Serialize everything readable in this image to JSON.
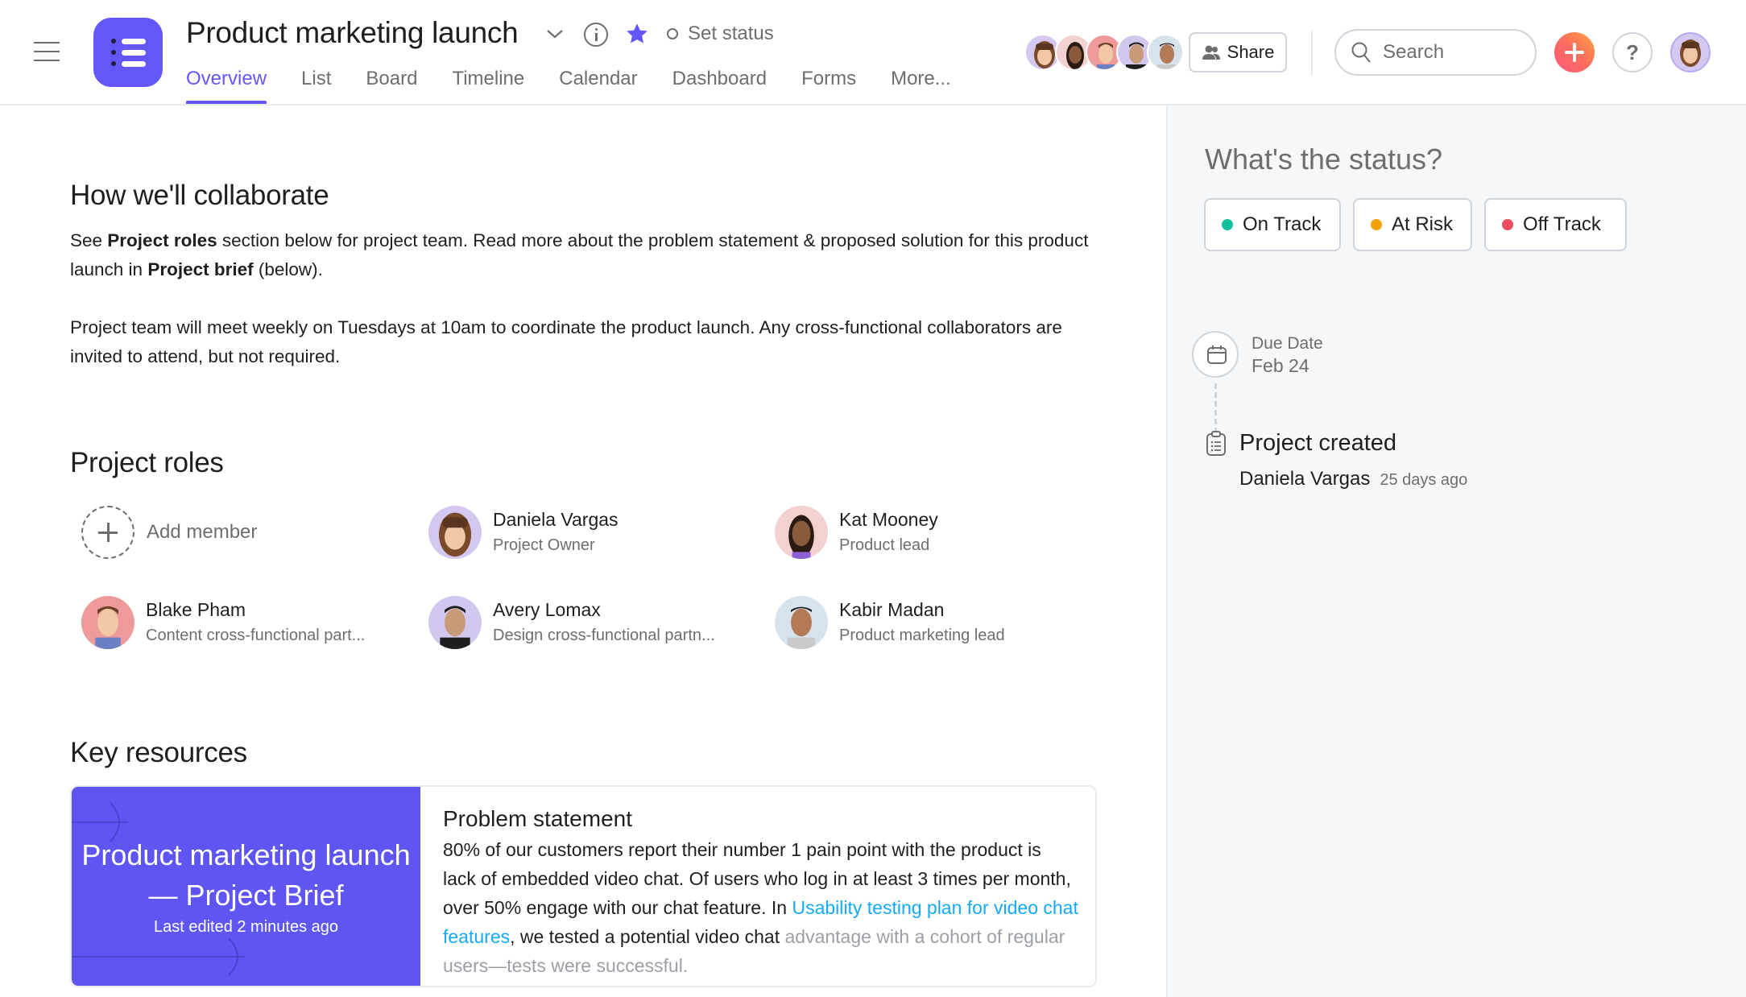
{
  "header": {
    "project_title": "Product marketing launch",
    "set_status_label": "Set status",
    "tabs": [
      {
        "label": "Overview",
        "active": true
      },
      {
        "label": "List",
        "active": false
      },
      {
        "label": "Board",
        "active": false
      },
      {
        "label": "Timeline",
        "active": false
      },
      {
        "label": "Calendar",
        "active": false
      },
      {
        "label": "Dashboard",
        "active": false
      },
      {
        "label": "Forms",
        "active": false
      },
      {
        "label": "More...",
        "active": false
      }
    ],
    "members_facepile": [
      "Daniela Vargas",
      "Kat Mooney",
      "Blake Pham",
      "Avery Lomax",
      "Kabir Madan"
    ],
    "share_label": "Share",
    "search_placeholder": "Search",
    "help_label": "?",
    "accent_color": "#6457f9"
  },
  "overview": {
    "collaborate": {
      "heading": "How we'll collaborate",
      "p1_a": "See ",
      "p1_b": "Project roles",
      "p1_c": " section below for project team. Read more about the problem statement & proposed solution for this product launch in ",
      "p1_d": "Project brief",
      "p1_e": " (below).",
      "p2": "Project team will meet weekly on Tuesdays at 10am to coordinate the product launch. Any cross-functional collaborators are invited to attend, but not required."
    },
    "roles": {
      "heading": "Project roles",
      "add_member_label": "Add member",
      "members": [
        {
          "name": "Daniela Vargas",
          "role": "Project Owner",
          "avatar_bg": "#d5c8f0"
        },
        {
          "name": "Kat Mooney",
          "role": "Product lead",
          "avatar_bg": "#f3d1d1"
        },
        {
          "name": "Blake Pham",
          "role": "Content cross-functional part...",
          "avatar_bg": "#ee9a9a"
        },
        {
          "name": "Avery Lomax",
          "role": "Design cross-functional partn...",
          "avatar_bg": "#d2c7ee"
        },
        {
          "name": "Kabir Madan",
          "role": "Product marketing lead",
          "avatar_bg": "#d6e2ec"
        }
      ]
    },
    "resources": {
      "heading": "Key resources",
      "brief_title": "Product marketing launch — Project Brief",
      "brief_edited": "Last edited 2 minutes ago",
      "problem_heading": "Problem statement",
      "problem_text_a": "80% of our customers report their number 1 pain point with the product is lack of embedded video chat. Of users who log in at least 3 times per month, over 50% engage with our chat feature. In ",
      "problem_link": "Usability testing plan for video chat features",
      "problem_text_b": ", we tested a potential video chat ",
      "problem_text_fade": "advantage with a cohort of regular users—tests were successful."
    }
  },
  "status_panel": {
    "heading": "What's the status?",
    "options": [
      {
        "label": "On Track",
        "color": "#14bf9c"
      },
      {
        "label": "At Risk",
        "color": "#f1a20b"
      },
      {
        "label": "Off Track",
        "color": "#ee4d5f"
      }
    ],
    "due_date_label": "Due Date",
    "due_date_value": "Feb 24",
    "event_title": "Project created",
    "event_user": "Daniela Vargas",
    "event_time": "25 days ago"
  }
}
